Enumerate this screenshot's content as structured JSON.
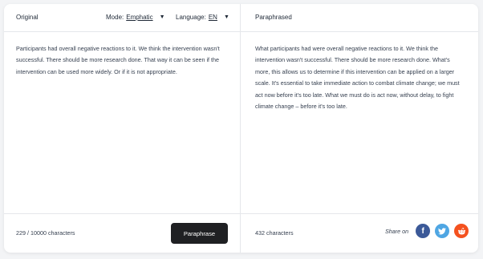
{
  "left": {
    "title": "Original",
    "mode_label": "Mode:",
    "mode_value": "Emphatic",
    "language_label": "Language:",
    "language_value": "EN",
    "text": "Participants had overall negative reactions to it. We think the intervention wasn't successful. There should be more research done. That way it can be seen if the intervention can be used more widely. Or if it is not appropriate.",
    "char_count": "229 / 10000 characters",
    "paraphrase_button": "Paraphrase"
  },
  "right": {
    "title": "Paraphrased",
    "text": "What participants had were overall negative reactions to it. We think the intervention wasn't successful. There should be more research done. What's more, this allows us to determine if this intervention can be applied on a larger scale. It's essential to take immediate action to combat climate change; we must act now before it's too late. What we must do is act now, without delay, to fight climate change – before it's too late.",
    "char_count": "432 characters",
    "share_label": "Share on",
    "share_icons": [
      "facebook-icon",
      "twitter-icon",
      "reddit-icon"
    ]
  },
  "colors": {
    "facebook": "#3b5998",
    "twitter": "#4fa6e3",
    "reddit": "#f4511e",
    "button_bg": "#1f2023"
  }
}
